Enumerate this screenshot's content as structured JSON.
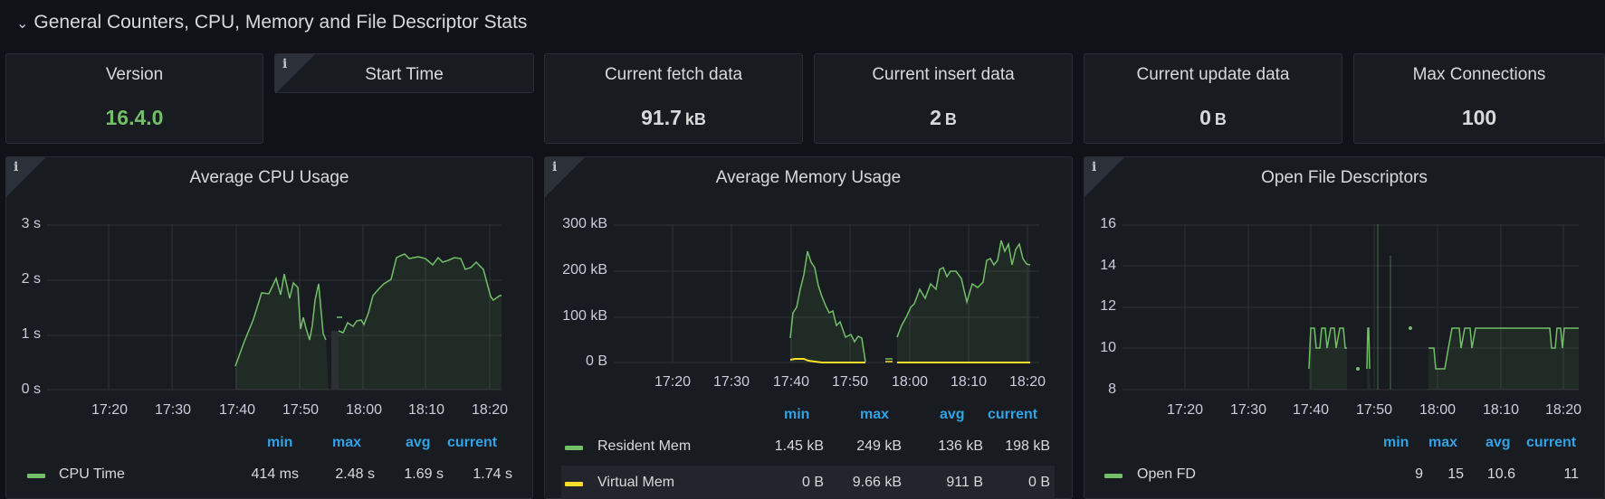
{
  "row": {
    "title": "General Counters, CPU, Memory and File Descriptor Stats",
    "chevron_icon": "chevron-down-icon"
  },
  "stats": {
    "version": {
      "title": "Version",
      "value": "16.4.0",
      "color": "#73bf69"
    },
    "start_time": {
      "title": "Start Time",
      "info": "i"
    },
    "fetch": {
      "title": "Current fetch data",
      "value": "91.7",
      "unit": "kB"
    },
    "insert": {
      "title": "Current insert data",
      "value": "2",
      "unit": "B"
    },
    "update": {
      "title": "Current update data",
      "value": "0",
      "unit": "B"
    },
    "max_conn": {
      "title": "Max Connections",
      "value": "100"
    }
  },
  "cpu": {
    "title": "Average CPU Usage",
    "info": "i",
    "y_ticks": [
      "3 s",
      "2 s",
      "1 s",
      "0 s"
    ],
    "x_ticks": [
      "17:20",
      "17:30",
      "17:40",
      "17:50",
      "18:00",
      "18:10",
      "18:20"
    ],
    "legend_headers": [
      "min",
      "max",
      "avg",
      "current"
    ],
    "series": [
      {
        "name": "CPU Time",
        "color": "#73bf69",
        "min": "414 ms",
        "max": "2.48 s",
        "avg": "1.69 s",
        "current": "1.74 s"
      }
    ]
  },
  "memory": {
    "title": "Average Memory Usage",
    "info": "i",
    "y_ticks": [
      "300 kB",
      "200 kB",
      "100 kB",
      "0 B"
    ],
    "x_ticks": [
      "17:20",
      "17:30",
      "17:40",
      "17:50",
      "18:00",
      "18:10",
      "18:20"
    ],
    "legend_headers": [
      "min",
      "max",
      "avg",
      "current"
    ],
    "series": [
      {
        "name": "Resident Mem",
        "color": "#73bf69",
        "min": "1.45 kB",
        "max": "249 kB",
        "avg": "136 kB",
        "current": "198 kB"
      },
      {
        "name": "Virtual Mem",
        "color": "#fade2a",
        "min": "0 B",
        "max": "9.66 kB",
        "avg": "911 B",
        "current": "0 B"
      }
    ]
  },
  "fd": {
    "title": "Open File Descriptors",
    "info": "i",
    "y_ticks": [
      "16",
      "14",
      "12",
      "10",
      "8"
    ],
    "x_ticks": [
      "17:20",
      "17:30",
      "17:40",
      "17:50",
      "18:00",
      "18:10",
      "18:20"
    ],
    "legend_headers": [
      "min",
      "max",
      "avg",
      "current"
    ],
    "series": [
      {
        "name": "Open FD",
        "color": "#73bf69",
        "min": "9",
        "max": "15",
        "avg": "10.6",
        "current": "11"
      }
    ]
  }
}
